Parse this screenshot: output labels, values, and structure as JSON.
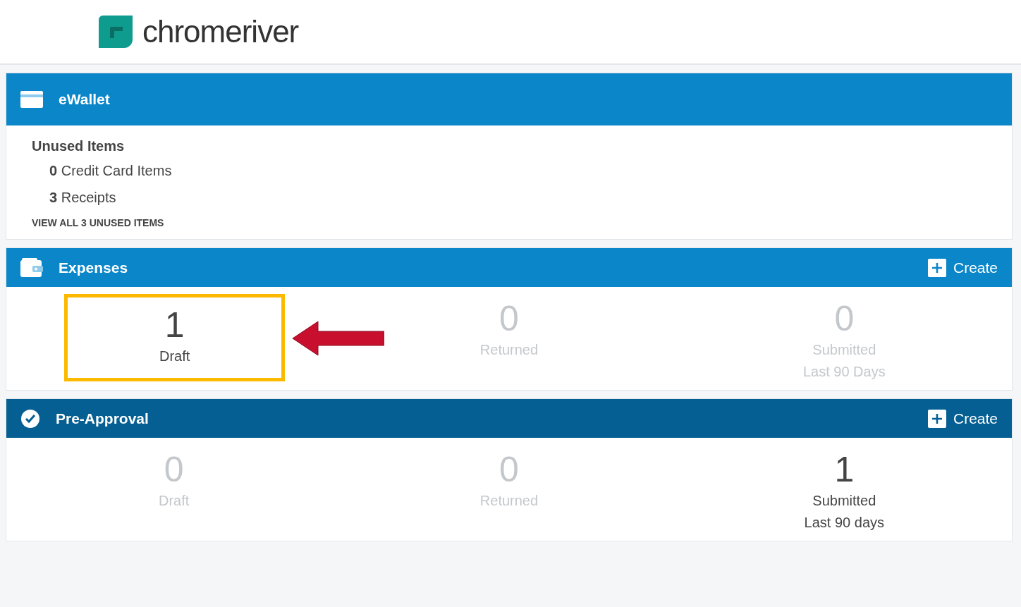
{
  "header": {
    "logo_text": "chromeriver"
  },
  "ewallet": {
    "title": "eWallet",
    "subtitle": "Unused Items",
    "items": [
      {
        "count": "0",
        "label": "Credit Card Items"
      },
      {
        "count": "3",
        "label": "Receipts"
      }
    ],
    "link": "VIEW ALL 3 UNUSED ITEMS"
  },
  "panels": [
    {
      "kind": "expenses",
      "title": "Expenses",
      "action": "Create",
      "stats": [
        {
          "count": "1",
          "label": "Draft",
          "active": true,
          "highlighted": true
        },
        {
          "count": "0",
          "label": "Returned",
          "active": false,
          "highlighted": false
        },
        {
          "count": "0",
          "label": "Submitted",
          "note": "Last 90 Days",
          "active": false,
          "highlighted": false
        }
      ]
    },
    {
      "kind": "preapproval",
      "title": "Pre-Approval",
      "action": "Create",
      "stats": [
        {
          "count": "0",
          "label": "Draft",
          "active": false,
          "highlighted": false
        },
        {
          "count": "0",
          "label": "Returned",
          "active": false,
          "highlighted": false
        },
        {
          "count": "1",
          "label": "Submitted",
          "note": "Last 90 days",
          "active": true,
          "highlighted": false
        }
      ]
    }
  ]
}
